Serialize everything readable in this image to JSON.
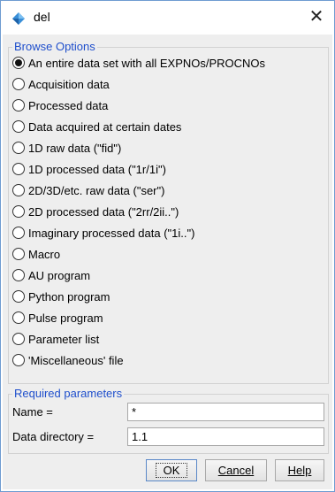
{
  "window": {
    "title": "del",
    "close_glyph": "✕",
    "icon": "app-diamond-icon",
    "accent_color": "#1f4fcc"
  },
  "browse": {
    "title": "Browse Options",
    "options": [
      {
        "label": "An entire data set with all EXPNOs/PROCNOs",
        "checked": true
      },
      {
        "label": "Acquisition data",
        "checked": false
      },
      {
        "label": "Processed data",
        "checked": false
      },
      {
        "label": "Data acquired at certain dates",
        "checked": false
      },
      {
        "label": "1D raw data (\"fid\")",
        "checked": false
      },
      {
        "label": "1D processed data (\"1r/1i\")",
        "checked": false
      },
      {
        "label": "2D/3D/etc. raw data (\"ser\")",
        "checked": false
      },
      {
        "label": "2D processed data (\"2rr/2ii..\")",
        "checked": false
      },
      {
        "label": "Imaginary processed data (\"1i..\")",
        "checked": false
      },
      {
        "label": "Macro",
        "checked": false
      },
      {
        "label": "AU program",
        "checked": false
      },
      {
        "label": "Python program",
        "checked": false
      },
      {
        "label": "Pulse program",
        "checked": false
      },
      {
        "label": "Parameter list",
        "checked": false
      },
      {
        "label": "'Miscellaneous' file",
        "checked": false
      }
    ]
  },
  "required": {
    "title": "Required parameters",
    "name_label": "Name =",
    "name_value": "*",
    "dir_label": "Data directory =",
    "dir_value": "1.1"
  },
  "buttons": {
    "ok": "OK",
    "cancel": "Cancel",
    "help": "Help"
  }
}
